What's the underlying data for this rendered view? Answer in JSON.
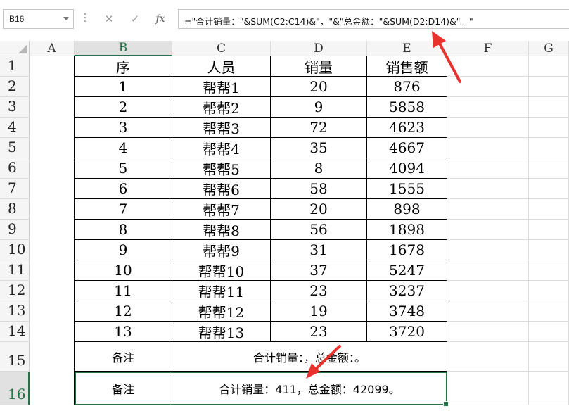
{
  "name_box": "B16",
  "formula_icons": [
    "cancel-icon",
    "enter-icon",
    "insert-function-icon"
  ],
  "formula_bar": {
    "fx_label": "fx",
    "formula": "=\"合计销量：\"&SUM(C2:C14)&\"，\"&\"总金额：\"&SUM(D2:D14)&\"。\""
  },
  "columns": [
    "A",
    "B",
    "C",
    "D",
    "E",
    "F",
    "G"
  ],
  "header_row": {
    "seq": "序",
    "person": "人员",
    "qty": "销量",
    "amount": "销售额"
  },
  "rows": [
    {
      "row": "2",
      "seq": "1",
      "person": "帮帮1",
      "qty": "20",
      "amount": "876"
    },
    {
      "row": "3",
      "seq": "2",
      "person": "帮帮2",
      "qty": "9",
      "amount": "5858"
    },
    {
      "row": "4",
      "seq": "3",
      "person": "帮帮3",
      "qty": "72",
      "amount": "4623"
    },
    {
      "row": "5",
      "seq": "4",
      "person": "帮帮4",
      "qty": "35",
      "amount": "4667"
    },
    {
      "row": "6",
      "seq": "5",
      "person": "帮帮5",
      "qty": "8",
      "amount": "4094"
    },
    {
      "row": "7",
      "seq": "6",
      "person": "帮帮6",
      "qty": "58",
      "amount": "1555"
    },
    {
      "row": "8",
      "seq": "7",
      "person": "帮帮7",
      "qty": "20",
      "amount": "898"
    },
    {
      "row": "9",
      "seq": "8",
      "person": "帮帮8",
      "qty": "56",
      "amount": "1898"
    },
    {
      "row": "10",
      "seq": "9",
      "person": "帮帮9",
      "qty": "31",
      "amount": "1678"
    },
    {
      "row": "11",
      "seq": "10",
      "person": "帮帮10",
      "qty": "37",
      "amount": "5247"
    },
    {
      "row": "12",
      "seq": "11",
      "person": "帮帮11",
      "qty": "23",
      "amount": "3237"
    },
    {
      "row": "13",
      "seq": "12",
      "person": "帮帮12",
      "qty": "19",
      "amount": "3748"
    },
    {
      "row": "14",
      "seq": "13",
      "person": "帮帮13",
      "qty": "23",
      "amount": "3720"
    }
  ],
  "note_rows": [
    {
      "row": "15",
      "label": "备注",
      "text": "合计销量：，总金额：。"
    },
    {
      "row": "16",
      "label": "备注",
      "text": "合计销量：411，总金额：42099。"
    }
  ],
  "colors": {
    "selection": "#217346",
    "arrow": "#e8322d"
  }
}
